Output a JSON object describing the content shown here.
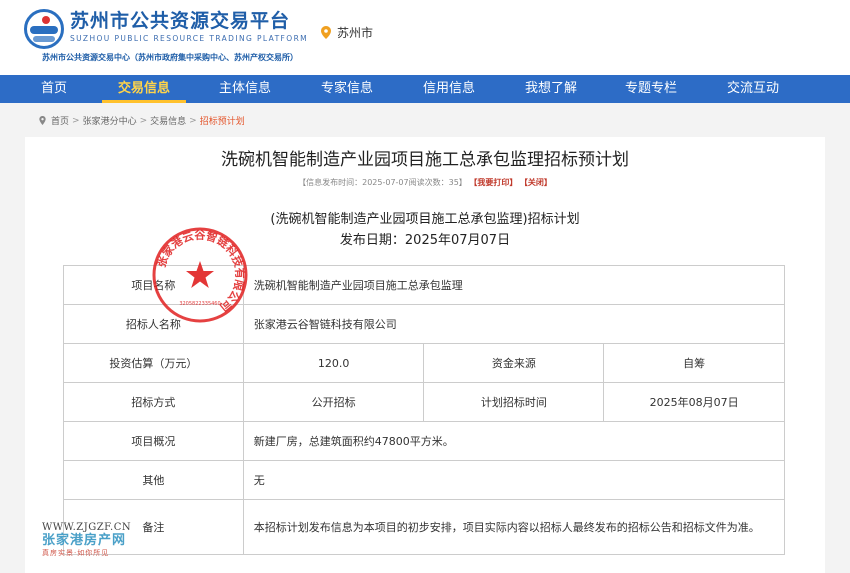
{
  "header": {
    "logo_title": "苏州市公共资源交易平台",
    "logo_en": "SUZHOU PUBLIC RESOURCE TRADING PLATFORM",
    "logo_sub": "苏州市公共资源交易中心（苏州市政府集中采购中心、苏州产权交易所）",
    "city": "苏州市"
  },
  "nav": {
    "items": [
      "首页",
      "交易信息",
      "主体信息",
      "专家信息",
      "信用信息",
      "我想了解",
      "专题专栏",
      "交流互动"
    ],
    "active_index": 1
  },
  "breadcrumb": {
    "items": [
      "首页",
      "张家港分中心",
      "交易信息",
      "招标预计划"
    ],
    "separator": ">"
  },
  "article": {
    "title": "洗碗机智能制造产业园项目施工总承包监理招标预计划",
    "meta_info": "【信息发布时间：2025-07-07阅读次数：35】",
    "print_label": "【我要打印】",
    "close_label": "【关闭】",
    "subtitle": "(洗碗机智能制造产业园项目施工总承包监理)招标计划",
    "pubdate": "发布日期：2025年07月07日"
  },
  "table": {
    "project_name_label": "项目名称",
    "project_name": "洗碗机智能制造产业园项目施工总承包监理",
    "tenderer_label": "招标人名称",
    "tenderer": "张家港云谷智链科技有限公司",
    "investment_label": "投资估算（万元）",
    "investment": "120.0",
    "fund_source_label": "资金来源",
    "fund_source": "自筹",
    "method_label": "招标方式",
    "method": "公开招标",
    "plan_time_label": "计划招标时间",
    "plan_time": "2025年08月07日",
    "overview_label": "项目概况",
    "overview": "新建厂房，总建筑面积约47800平方米。",
    "other_label": "其他",
    "other": "无",
    "remark_label": "备注",
    "remark": "本招标计划发布信息为本项目的初步安排，项目实际内容以招标人最终发布的招标公告和招标文件为准。"
  },
  "seal": {
    "text": "张家港云谷智链科技有限公司",
    "code": "3205822335460",
    "color": "#e02020"
  },
  "watermark": {
    "url": "WWW.ZJGZF.CN",
    "name": "张家港房产网",
    "slogan": "真房实景·如你所见"
  },
  "colors": {
    "nav_bg": "#2d6cc6",
    "nav_active": "#ffd44a",
    "brand": "#1f5ea8",
    "accent_red": "#e03e2d"
  }
}
